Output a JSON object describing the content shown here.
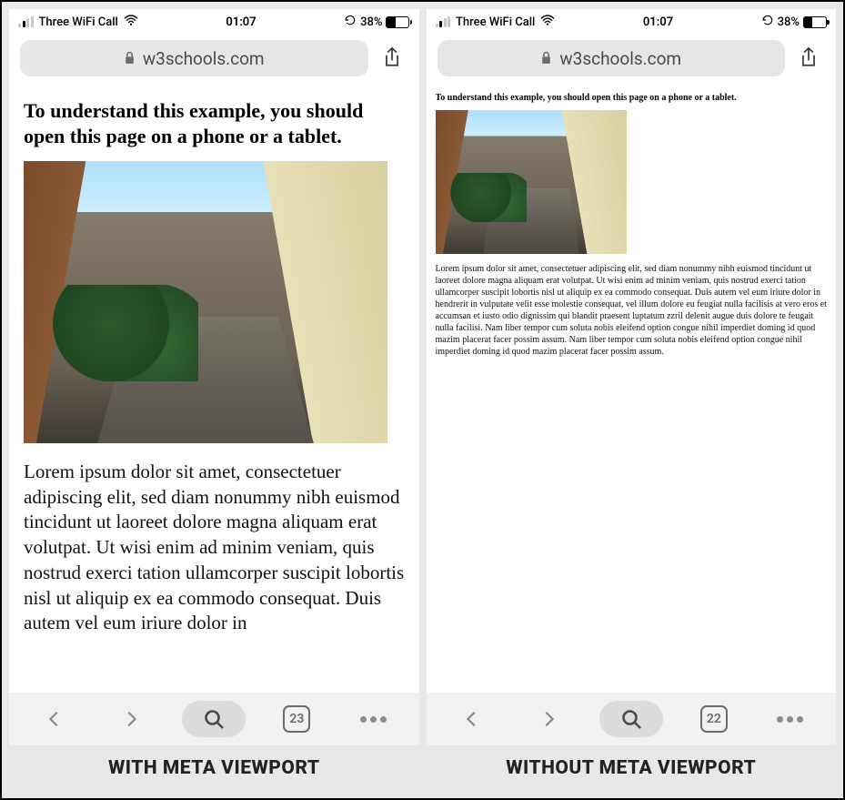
{
  "status": {
    "carrier": "Three WiFi Call",
    "time": "01:07",
    "battery_percent": "38%"
  },
  "browser": {
    "domain": "w3schools.com"
  },
  "page": {
    "heading": "To understand this example, you should open this page on a phone or a tablet.",
    "image_alt": "Mediterranean alleyway photo",
    "body_left": "Lorem ipsum dolor sit amet, consectetuer adipiscing elit, sed diam nonummy nibh euismod tincidunt ut laoreet dolore magna aliquam erat volutpat. Ut wisi enim ad minim veniam, quis nostrud exerci tation ullamcorper suscipit lobortis nisl ut aliquip ex ea commodo consequat. Duis autem vel eum iriure dolor in",
    "body_right": "Lorem ipsum dolor sit amet, consectetuer adipiscing elit, sed diam nonummy nibh euismod tincidunt ut laoreet dolore magna aliquam erat volutpat. Ut wisi enim ad minim veniam, quis nostrud exerci tation ullamcorper suscipit lobortis nisl ut aliquip ex ea commodo consequat. Duis autem vel eum iriure dolor in hendrerit in vulputate velit esse molestie consequat, vel illum dolore eu feugiat nulla facilisis at vero eros et accumsan et iusto odio dignissim qui blandit praesent luptatum zzril delenit augue duis dolore te feugait nulla facilisi. Nam liber tempor cum soluta nobis eleifend option congue nihil imperdiet doming id quod mazim placerat facer possim assum. Nam liber tempor cum soluta nobis eleifend option congue nihil imperdiet doming id quod mazim placerat facer possim assum."
  },
  "toolbar": {
    "tabs_left": "23",
    "tabs_right": "22"
  },
  "captions": {
    "left": "WITH META VIEWPORT",
    "right": "WITHOUT META VIEWPORT"
  }
}
